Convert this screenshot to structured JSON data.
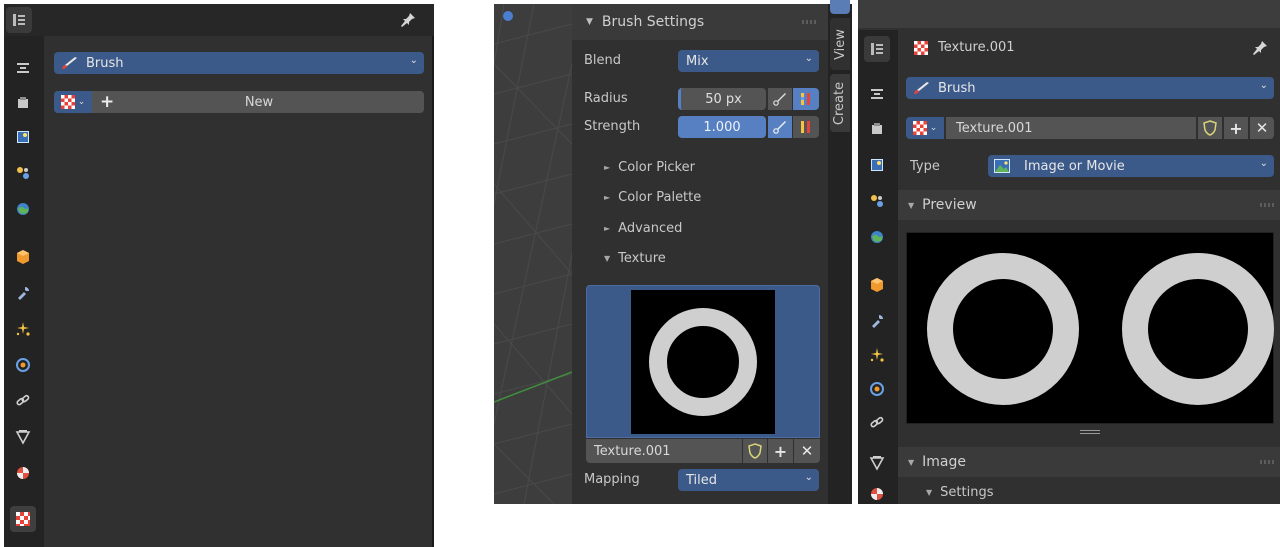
{
  "left_panel": {
    "brush_dropdown": "Brush",
    "new_button": "New"
  },
  "middle_panel": {
    "brush_settings_title": "Brush Settings",
    "blend_label": "Blend",
    "blend_value": "Mix",
    "radius_label": "Radius",
    "radius_value": "50 px",
    "strength_label": "Strength",
    "strength_value": "1.000",
    "strength_fraction": 1.0,
    "sections": [
      "Color Picker",
      "Color Palette",
      "Advanced"
    ],
    "texture_section": "Texture",
    "texture_name": "Texture.001",
    "mapping_label": "Mapping",
    "mapping_value": "Tiled",
    "side_tabs": [
      "View",
      "Create"
    ]
  },
  "right_panel": {
    "texture_title": "Texture.001",
    "brush_dropdown": "Brush",
    "texture_field": "Texture.001",
    "type_label": "Type",
    "type_value": "Image or Movie",
    "preview_title": "Preview",
    "image_section": "Image",
    "settings_section": "Settings"
  },
  "colors": {
    "panel_bg": "#303030",
    "tabstrip_bg": "#232323",
    "dropdown_blue": "#3b5a8a",
    "slider_blue": "#5680c2",
    "viewport_grey": "#3d3d3d"
  }
}
